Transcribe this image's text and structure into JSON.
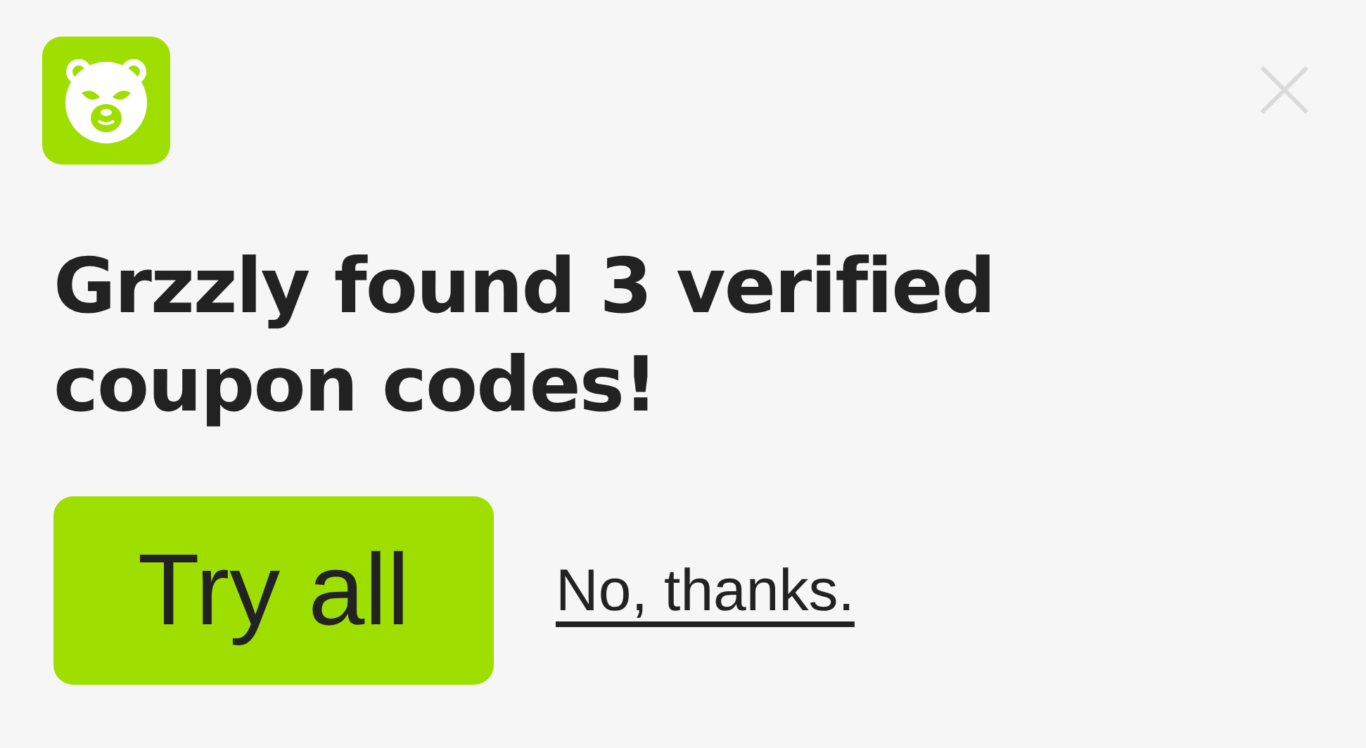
{
  "headline": "Grzzly found 3 verified coupon codes!",
  "buttons": [
    {
      "kind": "primary",
      "label": "Try all"
    },
    {
      "kind": "link",
      "label": "No, thanks."
    }
  ]
}
